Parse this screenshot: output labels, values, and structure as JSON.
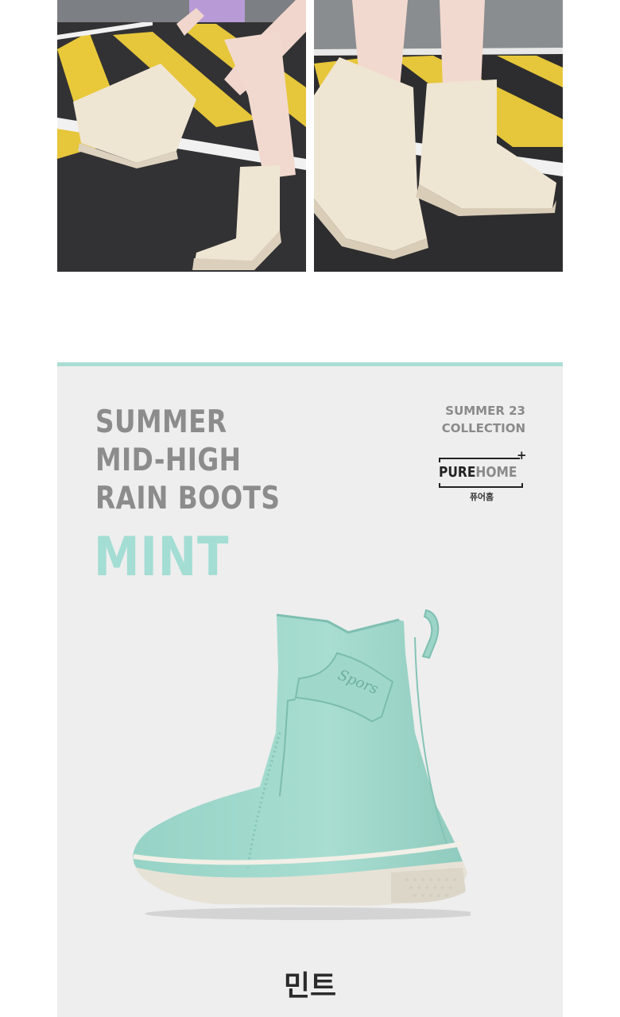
{
  "product": {
    "title_lines": [
      "SUMMER",
      "MID-HIGH",
      "RAIN BOOTS"
    ],
    "color_name": "MINT",
    "color_name_ko": "민트",
    "collection_lines": [
      "SUMMER 23",
      "COLLECTION"
    ]
  },
  "brand": {
    "name_part1": "PURE",
    "name_part2": "HOME",
    "name_ko": "퓨어홈",
    "plus": "+"
  },
  "colors": {
    "accent_mint": "#a3ddd3",
    "topbar": "#a9ddd4",
    "panel_bg": "#eeeeee",
    "title_gray": "#8c8c8c"
  }
}
